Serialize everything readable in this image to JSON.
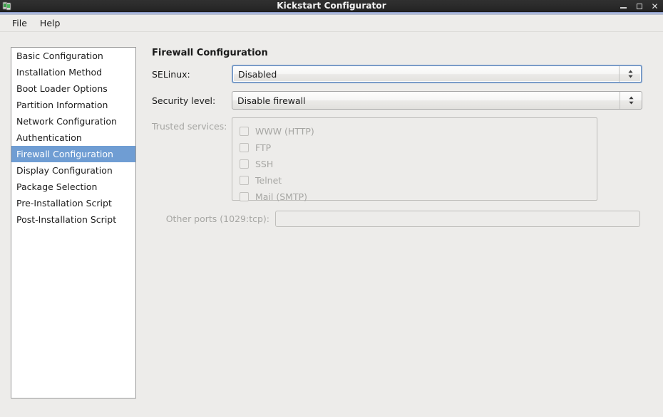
{
  "window": {
    "title": "Kickstart Configurator",
    "icon": "app-icon",
    "controls": {
      "minimize": "minimize-icon",
      "maximize": "maximize-icon",
      "close": "close-icon"
    }
  },
  "menubar": {
    "items": [
      {
        "label": "File"
      },
      {
        "label": "Help"
      }
    ]
  },
  "sidebar": {
    "items": [
      {
        "label": "Basic Configuration",
        "selected": false
      },
      {
        "label": "Installation Method",
        "selected": false
      },
      {
        "label": "Boot Loader Options",
        "selected": false
      },
      {
        "label": "Partition Information",
        "selected": false
      },
      {
        "label": "Network Configuration",
        "selected": false
      },
      {
        "label": "Authentication",
        "selected": false
      },
      {
        "label": "Firewall Configuration",
        "selected": true
      },
      {
        "label": "Display Configuration",
        "selected": false
      },
      {
        "label": "Package Selection",
        "selected": false
      },
      {
        "label": "Pre-Installation Script",
        "selected": false
      },
      {
        "label": "Post-Installation Script",
        "selected": false
      }
    ]
  },
  "main": {
    "heading": "Firewall Configuration",
    "selinux": {
      "label": "SELinux:",
      "value": "Disabled",
      "focused": true
    },
    "security_level": {
      "label": "Security level:",
      "value": "Disable firewall",
      "focused": false
    },
    "trusted_services": {
      "label": "Trusted services:",
      "disabled": true,
      "items": [
        {
          "label": "WWW (HTTP)",
          "checked": false
        },
        {
          "label": "FTP",
          "checked": false
        },
        {
          "label": "SSH",
          "checked": false
        },
        {
          "label": "Telnet",
          "checked": false
        },
        {
          "label": "Mail (SMTP)",
          "checked": false
        }
      ]
    },
    "other_ports": {
      "label": "Other ports (1029:tcp):",
      "value": "",
      "placeholder": "",
      "disabled": true
    }
  },
  "colors": {
    "titlebar": "#2a2a2a",
    "accent_selection": "#6f9dd3",
    "background": "#edecea",
    "focus_border": "#7a9cc8",
    "disabled_text": "#a6a6a3"
  }
}
